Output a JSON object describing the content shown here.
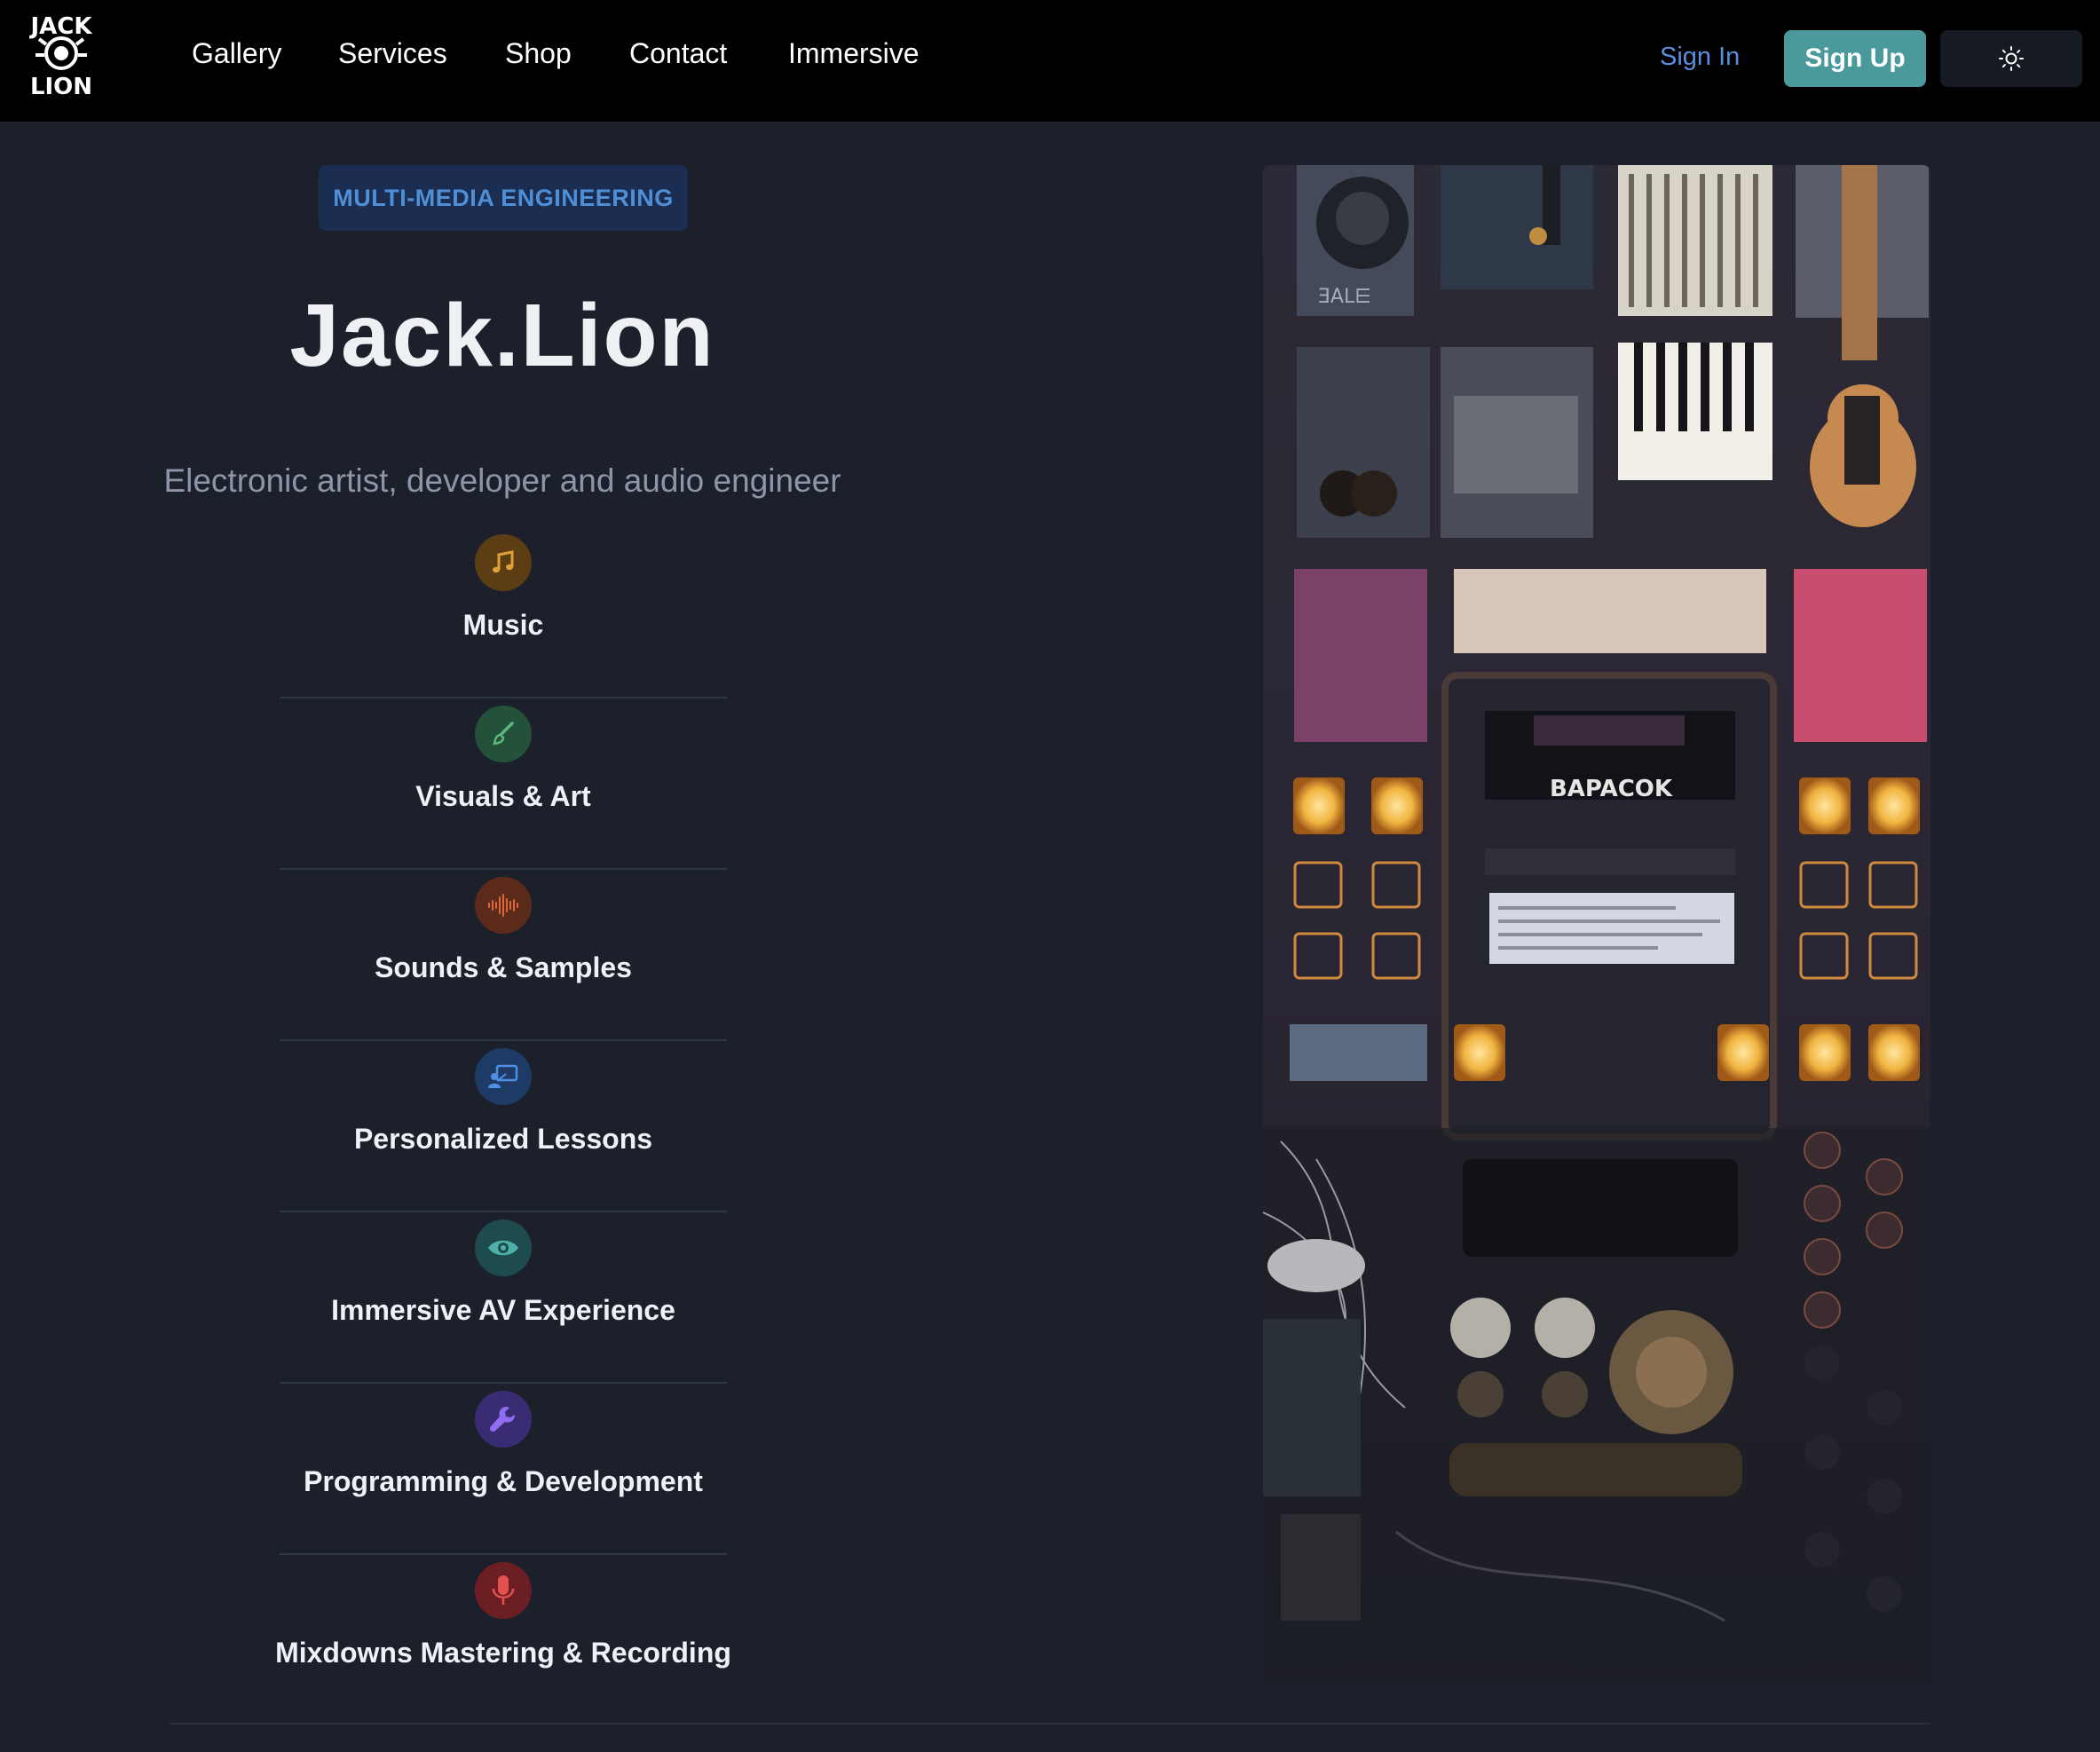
{
  "header": {
    "logo_text_top": "JACK",
    "logo_text_bottom": "LION",
    "nav": [
      "Gallery",
      "Services",
      "Shop",
      "Contact",
      "Immersive"
    ],
    "sign_in": "Sign In",
    "sign_up": "Sign Up",
    "theme_toggle_icon": "sun-icon"
  },
  "hero": {
    "badge": "MULTI-MEDIA ENGINEERING",
    "title": "Jack.Lion",
    "subtitle": "Electronic artist, developer and audio engineer"
  },
  "services": [
    {
      "label": "Music",
      "icon": "music-note-icon",
      "color": "#e0a13a",
      "bg": "#5c3d14"
    },
    {
      "label": "Visuals & Art",
      "icon": "paintbrush-icon",
      "color": "#5cb87a",
      "bg": "#23513a"
    },
    {
      "label": "Sounds & Samples",
      "icon": "soundwave-icon",
      "color": "#e0673a",
      "bg": "#5c2a1a"
    },
    {
      "label": "Personalized Lessons",
      "icon": "teacher-board-icon",
      "color": "#4e8fe6",
      "bg": "#1e3b66"
    },
    {
      "label": "Immersive AV Experience",
      "icon": "eye-icon",
      "color": "#4fb0aa",
      "bg": "#1e4c4e"
    },
    {
      "label": "Programming & Development",
      "icon": "wrench-icon",
      "color": "#8f6cf0",
      "bg": "#3a2c72"
    },
    {
      "label": "Mixdowns Mastering & Recording",
      "icon": "microphone-icon",
      "color": "#e45050",
      "bg": "#6b1f22"
    }
  ],
  "image": {
    "device_label": "BAPACOK",
    "knob_label": "ƎAL⋿"
  },
  "colors": {
    "background": "#1b202b",
    "header": "#000000",
    "accent_teal": "#4a9a9c",
    "link_blue": "#5a8fe0"
  }
}
